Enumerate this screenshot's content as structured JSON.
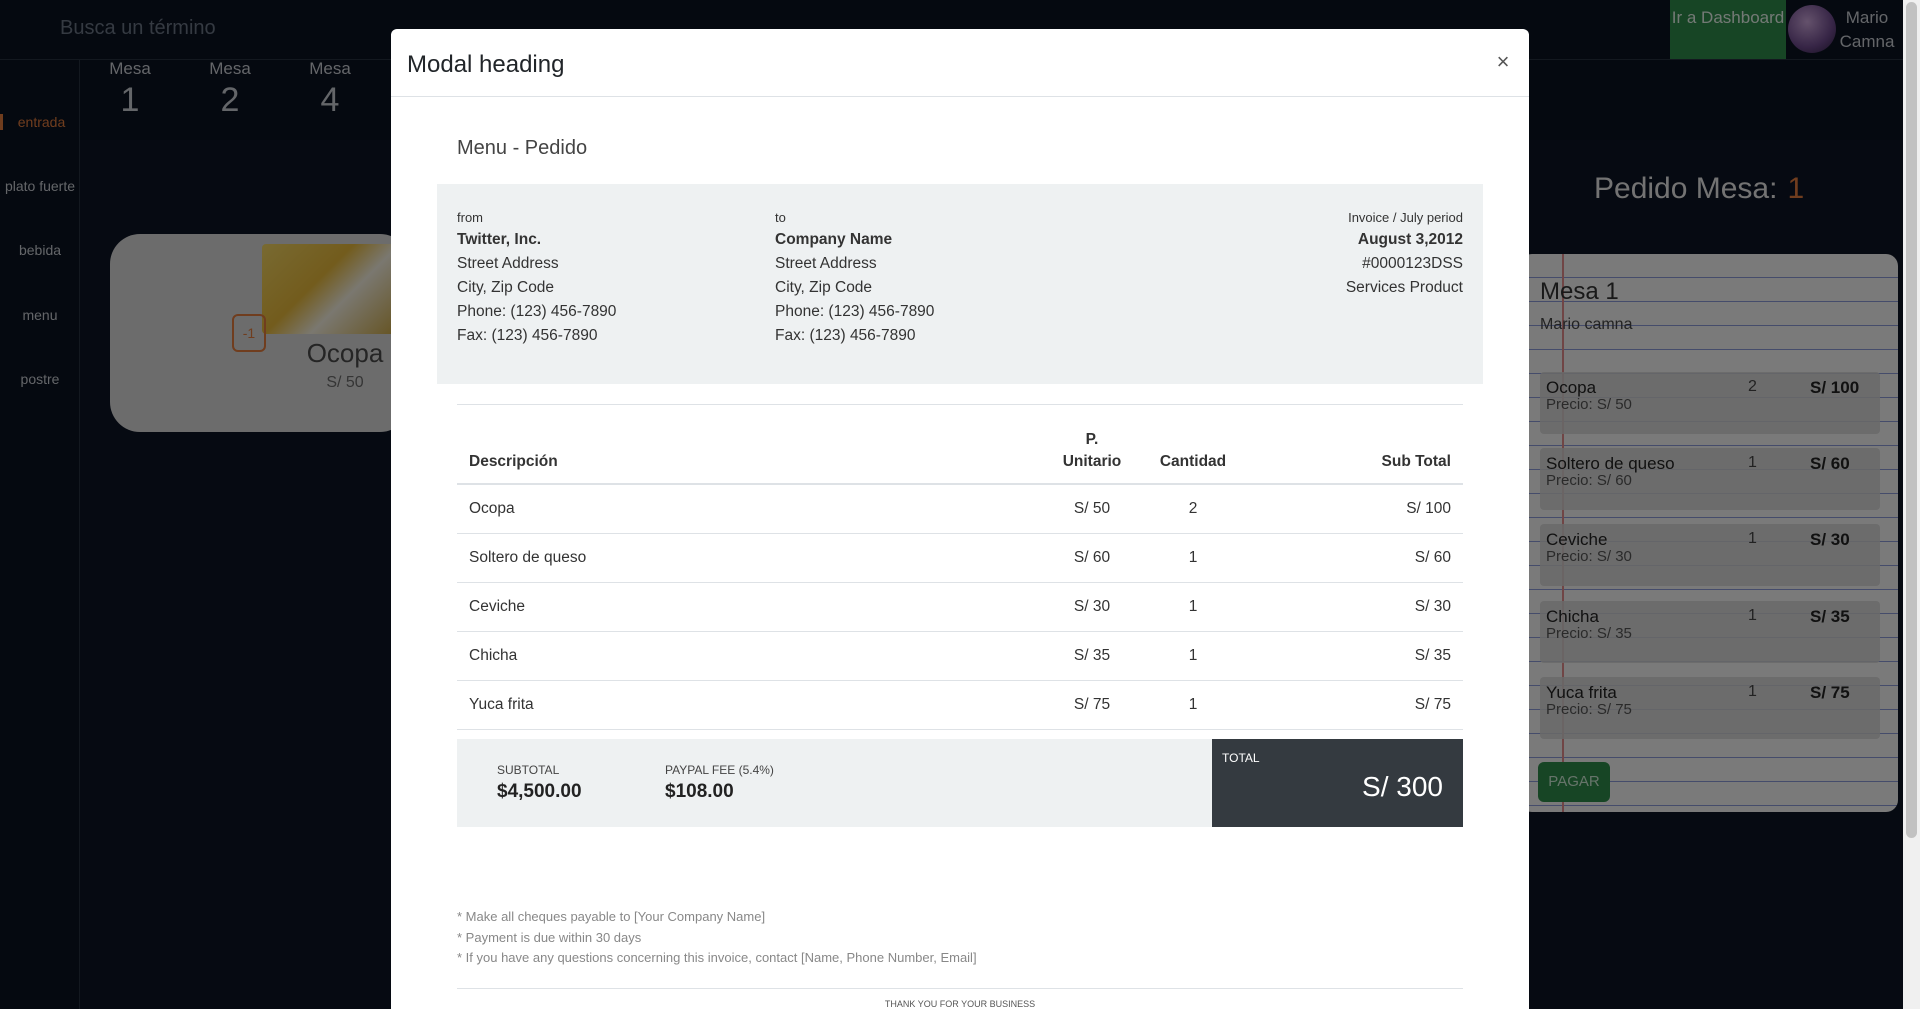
{
  "app": {
    "search_placeholder": "Busca un término",
    "dashboard_button": "Ir a Dashboard",
    "user_name": "Mario Camna"
  },
  "sidebar": {
    "items": [
      "entrada",
      "plato fuerte",
      "bebida",
      "menu",
      "postre"
    ],
    "active": "entrada"
  },
  "mesas": [
    {
      "label": "Mesa",
      "number": "1"
    },
    {
      "label": "Mesa",
      "number": "2"
    },
    {
      "label": "Mesa",
      "number": "4"
    }
  ],
  "food_card": {
    "name": "Ocopa",
    "price": "S/ 50",
    "minus_label": "-1"
  },
  "pedido": {
    "title": "Pedido Mesa:",
    "mesa_number": "1",
    "notebook_title": "Mesa 1",
    "notebook_subtitle": "Mario camna",
    "items": [
      {
        "name": "Ocopa",
        "price": "Precio: S/ 50",
        "qty": "2",
        "subtotal": "S/ 100"
      },
      {
        "name": "Soltero de queso",
        "price": "Precio: S/ 60",
        "qty": "1",
        "subtotal": "S/ 60"
      },
      {
        "name": "Ceviche",
        "price": "Precio: S/ 30",
        "qty": "1",
        "subtotal": "S/ 30"
      },
      {
        "name": "Chicha",
        "price": "Precio: S/ 35",
        "qty": "1",
        "subtotal": "S/ 35"
      },
      {
        "name": "Yuca frita",
        "price": "Precio: S/ 75",
        "qty": "1",
        "subtotal": "S/ 75"
      }
    ],
    "pay_button": "PAGAR"
  },
  "modal": {
    "title": "Modal heading",
    "close": "×",
    "heading": "Menu - Pedido",
    "from": {
      "label": "from",
      "name": "Twitter, Inc.",
      "address": "Street Address",
      "city": "City, Zip Code",
      "phone": "Phone: (123) 456-7890",
      "fax": "Fax: (123) 456-7890"
    },
    "to": {
      "label": "to",
      "name": "Company Name",
      "address": "Street Address",
      "city": "City, Zip Code",
      "phone": "Phone: (123) 456-7890",
      "fax": "Fax: (123) 456-7890"
    },
    "invoice": {
      "period": "Invoice / July period",
      "date": "August 3,2012",
      "number": "#0000123DSS",
      "type": "Services Product"
    },
    "table": {
      "headers": {
        "desc": "Descripción",
        "unit_1": "P.",
        "unit_2": "Unitario",
        "qty": "Cantidad",
        "subtotal": "Sub Total"
      },
      "rows": [
        {
          "desc": "Ocopa",
          "unit": "S/ 50",
          "qty": "2",
          "subtotal": "S/ 100"
        },
        {
          "desc": "Soltero de queso",
          "unit": "S/ 60",
          "qty": "1",
          "subtotal": "S/ 60"
        },
        {
          "desc": "Ceviche",
          "unit": "S/ 30",
          "qty": "1",
          "subtotal": "S/ 30"
        },
        {
          "desc": "Chicha",
          "unit": "S/ 35",
          "qty": "1",
          "subtotal": "S/ 35"
        },
        {
          "desc": "Yuca frita",
          "unit": "S/ 75",
          "qty": "1",
          "subtotal": "S/ 75"
        }
      ]
    },
    "totals": {
      "subtotal_label": "SUBTOTAL",
      "subtotal_value": "$4,500.00",
      "fee_label": "PAYPAL FEE (5.4%)",
      "fee_value": "$108.00",
      "total_label": "TOTAL",
      "total_value": "S/ 300"
    },
    "notes": [
      "* Make all cheques payable to [Your Company Name]",
      "* Payment is due within 30 days",
      "* If you have any questions concerning this invoice, contact [Name, Phone Number, Email]"
    ],
    "thanks": "THANK YOU FOR YOUR BUSINESS"
  },
  "colors": {
    "accent": "#e07a3c",
    "green": "#2e8b4a",
    "bg": "#0d1524",
    "total_dark": "#343a40"
  }
}
